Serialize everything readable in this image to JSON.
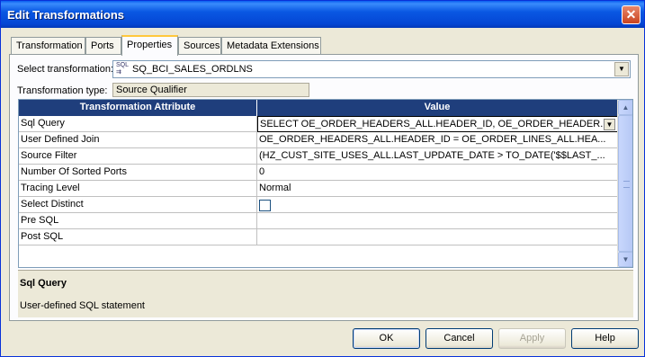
{
  "window": {
    "title": "Edit Transformations",
    "close_symbol": "✕"
  },
  "tabs": [
    {
      "label": "Transformation"
    },
    {
      "label": "Ports"
    },
    {
      "label": "Properties"
    },
    {
      "label": "Sources"
    },
    {
      "label": "Metadata Extensions"
    }
  ],
  "active_tab": "Properties",
  "select_transformation": {
    "label": "Select transformation:",
    "value": "SQ_BCI_SALES_ORDLNS",
    "icon": "sql-icon"
  },
  "transformation_type": {
    "label": "Transformation type:",
    "value": "Source Qualifier"
  },
  "grid": {
    "headers": [
      "Transformation Attribute",
      "Value"
    ],
    "rows": [
      {
        "attribute": "Sql Query",
        "value": "SELECT OE_ORDER_HEADERS_ALL.HEADER_ID, OE_ORDER_HEADER..."
      },
      {
        "attribute": "User Defined Join",
        "value": "OE_ORDER_HEADERS_ALL.HEADER_ID = OE_ORDER_LINES_ALL.HEA..."
      },
      {
        "attribute": "Source Filter",
        "value": "(HZ_CUST_SITE_USES_ALL.LAST_UPDATE_DATE > TO_DATE('$$LAST_..."
      },
      {
        "attribute": "Number Of Sorted Ports",
        "value": "0"
      },
      {
        "attribute": "Tracing Level",
        "value": "Normal"
      },
      {
        "attribute": "Select Distinct",
        "value": ""
      },
      {
        "attribute": "Pre SQL",
        "value": ""
      },
      {
        "attribute": "Post SQL",
        "value": ""
      }
    ]
  },
  "description": {
    "title": "Sql Query",
    "text": "User-defined SQL statement"
  },
  "buttons": {
    "ok": "OK",
    "cancel": "Cancel",
    "apply": "Apply",
    "help": "Help"
  }
}
